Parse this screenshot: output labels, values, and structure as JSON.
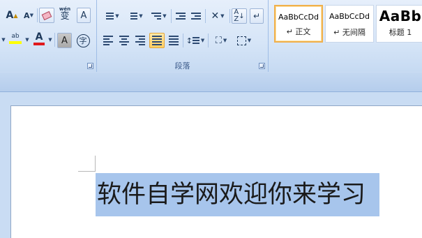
{
  "ribbon": {
    "font_group": {
      "row1": {
        "grow_font": "A",
        "shrink_font": "A",
        "phonetic_label": "wén",
        "phonetic_char": "变",
        "char_border": "A"
      },
      "row2": {
        "highlight_label": "ab",
        "font_color": "A",
        "char_shading": "A",
        "enclose": "字"
      }
    },
    "paragraph_group": {
      "label": "段落"
    },
    "styles_group": {
      "items": [
        {
          "sample": "AaBbCcDd",
          "name": "↵ 正文"
        },
        {
          "sample": "AaBbCcDd",
          "name": "↵ 无间隔"
        },
        {
          "sample": "AaBb",
          "name": "标题 1"
        }
      ]
    }
  },
  "document": {
    "text": "软件自学网欢迎你来学习"
  },
  "colors": {
    "highlight": "#ffff00",
    "font_color": "#e0191d",
    "selection": "#a7c5ec"
  }
}
